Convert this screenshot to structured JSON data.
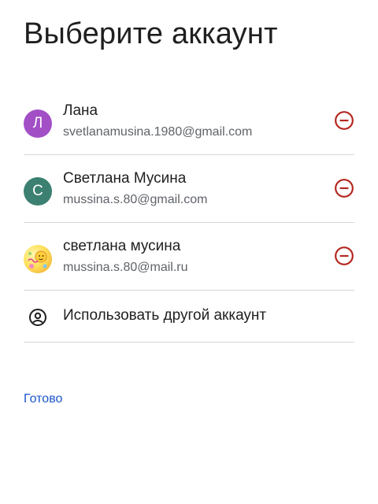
{
  "header": {
    "title": "Выберите аккаунт"
  },
  "accounts": [
    {
      "name": "Лана",
      "email": "svetlanamusina.1980@gmail.com",
      "avatar_letter": "Л",
      "avatar_color": "#a24fc6",
      "remove_icon": "remove-circle-icon"
    },
    {
      "name": "Светлана Мусина",
      "email": "mussina.s.80@gmail.com",
      "avatar_letter": "С",
      "avatar_color": "#3b8070",
      "remove_icon": "remove-circle-icon"
    },
    {
      "name": "светлана мусина",
      "email": "mussina.s.80@mail.ru",
      "avatar_letter": "",
      "avatar_color": "",
      "remove_icon": "remove-circle-icon"
    }
  ],
  "other_account": {
    "label": "Использовать другой аккаунт",
    "icon": "account-circle-icon"
  },
  "footer": {
    "done_label": "Готово"
  },
  "colors": {
    "remove_icon": "#b3261e",
    "link": "#1a56c9",
    "divider": "#d6d6d6",
    "secondary_text": "#5f6368"
  }
}
